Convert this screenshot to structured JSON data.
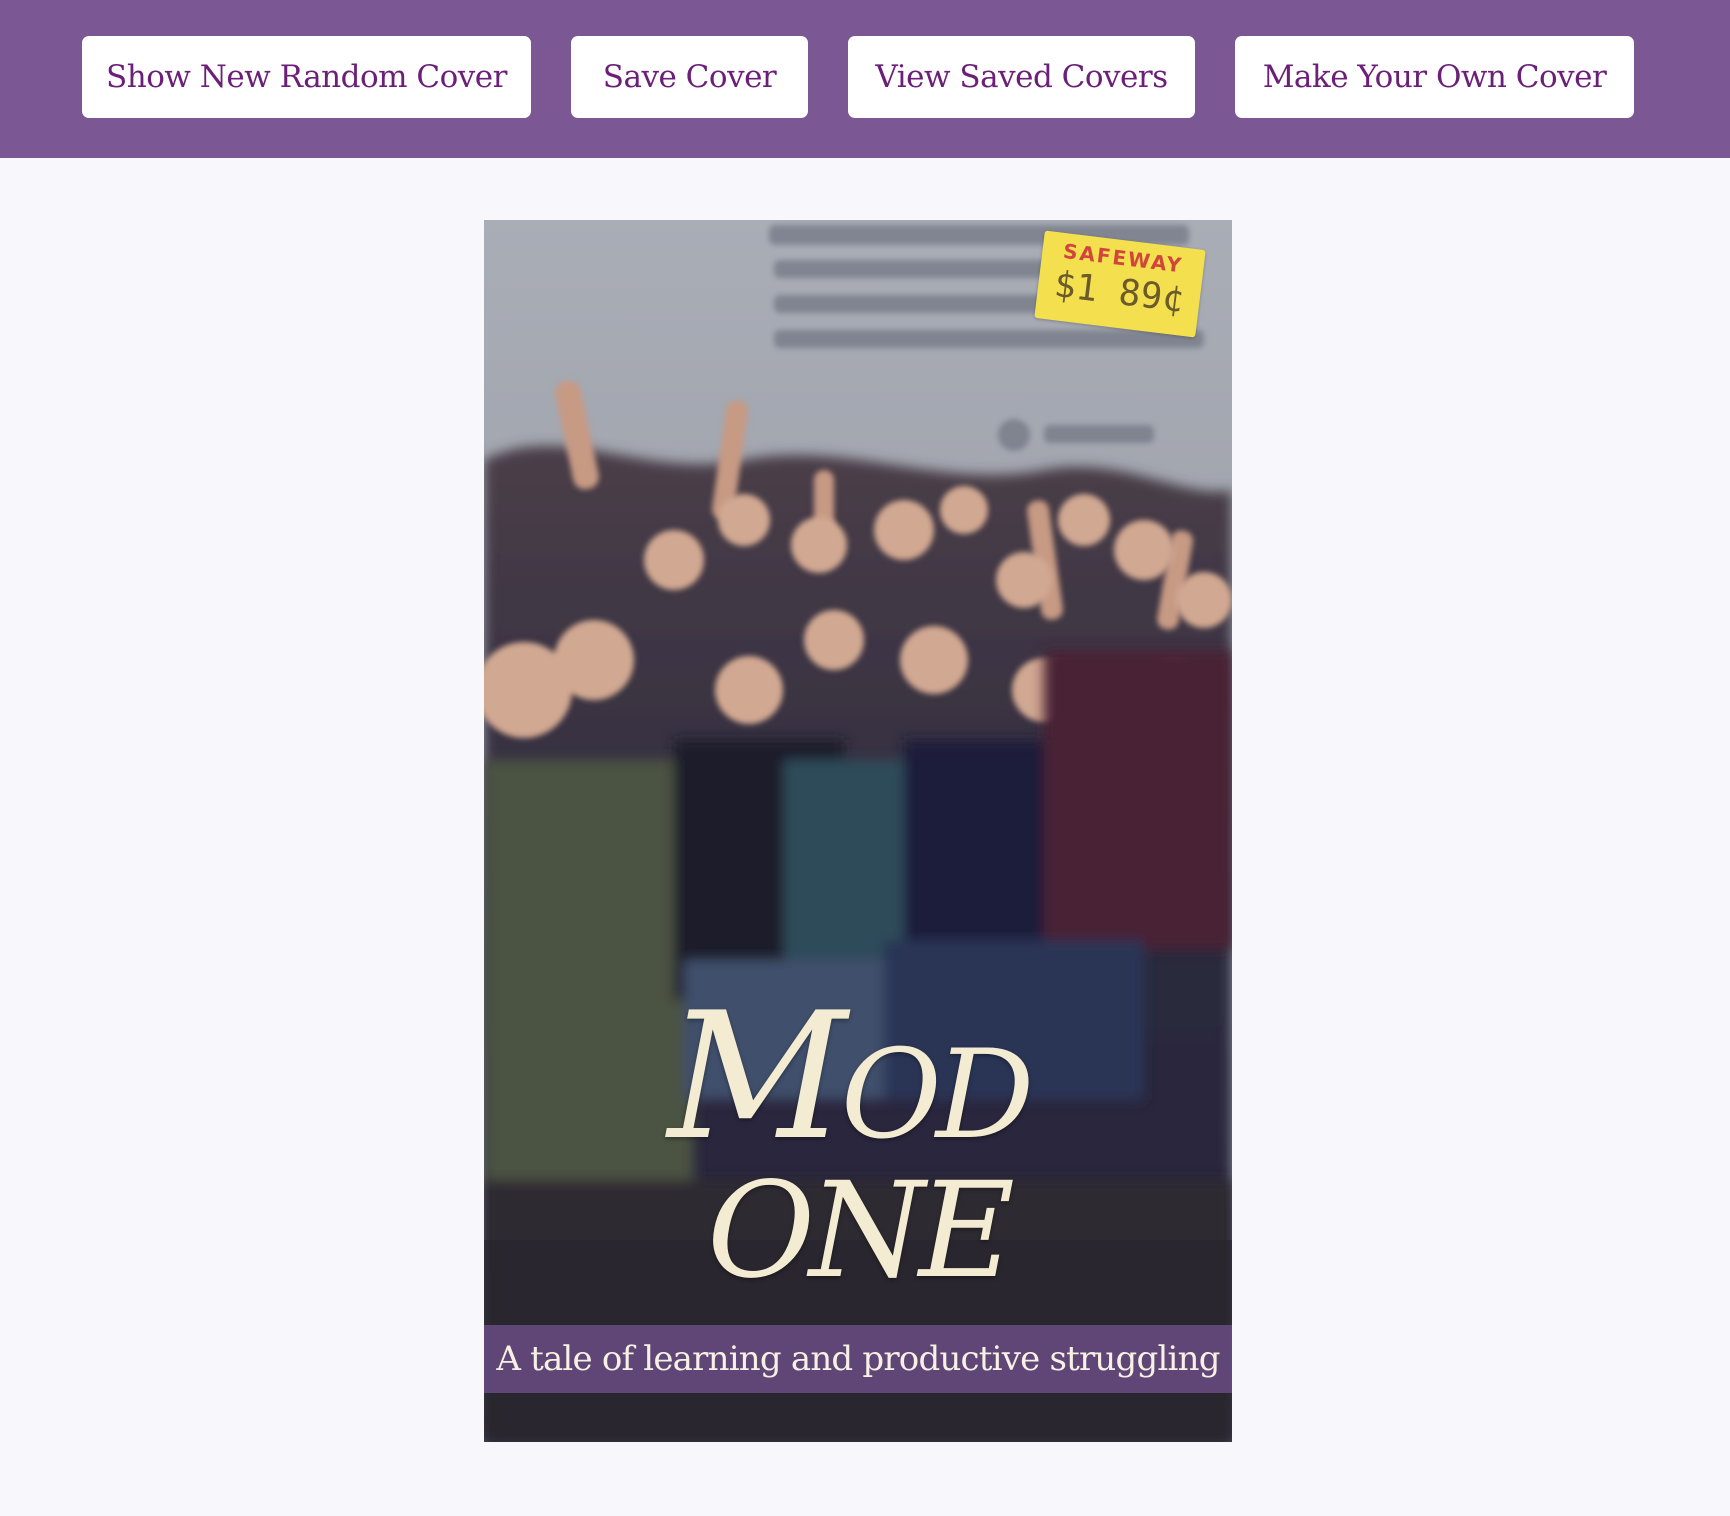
{
  "nav": {
    "random_label": "Show New Random Cover",
    "save_label": "Save Cover",
    "view_saved_label": "View Saved Covers",
    "make_own_label": "Make Your Own Cover"
  },
  "cover": {
    "title_line1": "Mod",
    "title_line2": "ONE",
    "tagline": "A tale of learning and productive struggling",
    "price_tag": {
      "store": "SAFEWAY",
      "price": "$1 89¢"
    },
    "image_description_icon": "cover-photo-classroom-hands-raised"
  },
  "colors": {
    "header_bg": "#7b5893",
    "button_text": "#6b1f78",
    "button_bg": "#ffffff",
    "page_bg": "#f8f7fc",
    "title_color": "#f3ecd3",
    "tagline_band": "#6e508c"
  }
}
